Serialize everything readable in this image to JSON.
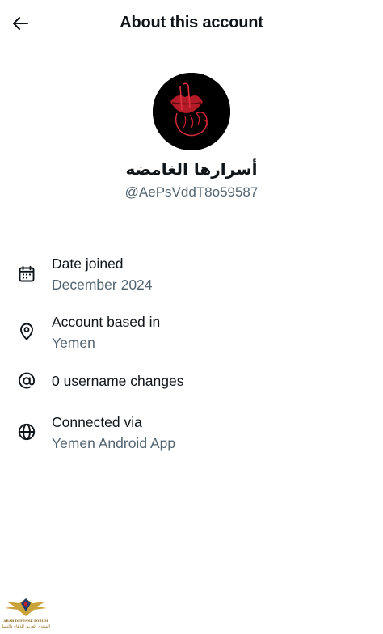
{
  "header": {
    "title": "About this account",
    "back_icon": "arrow-left-icon"
  },
  "profile": {
    "display_name": "أسرارها الغامضه",
    "handle": "@AePsVddT8o59587",
    "avatar_bg": "#000000",
    "avatar_accent": "#c41e2a"
  },
  "info": [
    {
      "icon": "calendar-icon",
      "label": "Date joined",
      "value": "December 2024"
    },
    {
      "icon": "location-pin-icon",
      "label": "Account based in",
      "value": "Yemen"
    },
    {
      "icon": "at-sign-icon",
      "label": "0 username changes"
    },
    {
      "icon": "globe-icon",
      "label": "Connected via",
      "value": "Yemen Android App"
    }
  ],
  "watermark": {
    "line1": "ARAB DEFENSE FORUM",
    "line2": "المنتدى العربي للدفاع والتسليح"
  },
  "colors": {
    "text_primary": "#0f1419",
    "text_secondary": "#536471",
    "background": "#ffffff"
  }
}
